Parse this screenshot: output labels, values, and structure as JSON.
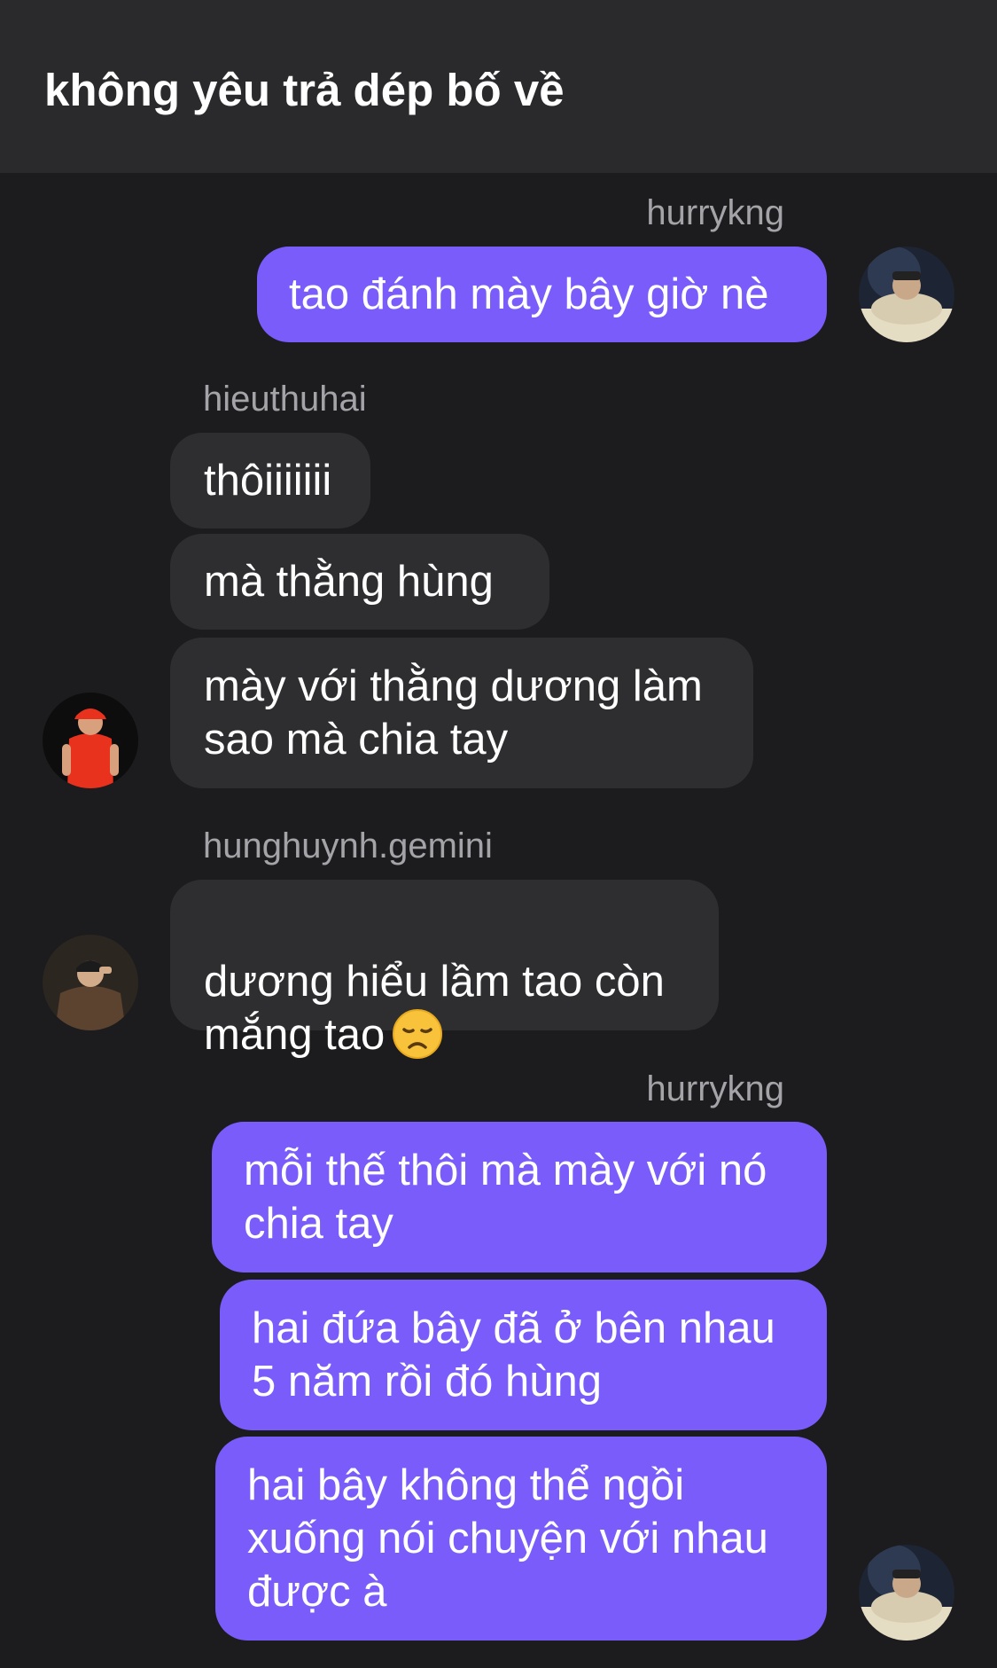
{
  "header": {
    "title": "không yêu trả dép bố về"
  },
  "messages": [
    {
      "sender": "hurrykng",
      "side": "outgoing",
      "bubbles": [
        "tao đánh mày bây giờ nè"
      ]
    },
    {
      "sender": "hieuthuhai",
      "side": "incoming",
      "bubbles": [
        "thôiiiiiii",
        "mà thằng hùng",
        "mày với thằng dương làm\nsao mà chia tay"
      ]
    },
    {
      "sender": "hunghuynh.gemini",
      "side": "incoming",
      "bubbles": [
        "dương hiểu lầm tao còn\nmắng tao"
      ],
      "emoji": "disappointed-face"
    },
    {
      "sender": "hurrykng",
      "side": "outgoing",
      "bubbles": [
        "mỗi thế thôi mà mày với nó\nchia tay",
        "hai đứa bây đã ở bên nhau\n5 năm rồi đó hùng",
        "hai bây không thể ngồi\nxuống nói chuyện với nhau\nđược à"
      ]
    }
  ],
  "colors": {
    "background": "#1c1c1e",
    "header": "#2a2a2c",
    "outgoing_bubble": "#7a5cfb",
    "incoming_bubble": "#2e2e31",
    "username": "#a4a4a8"
  }
}
